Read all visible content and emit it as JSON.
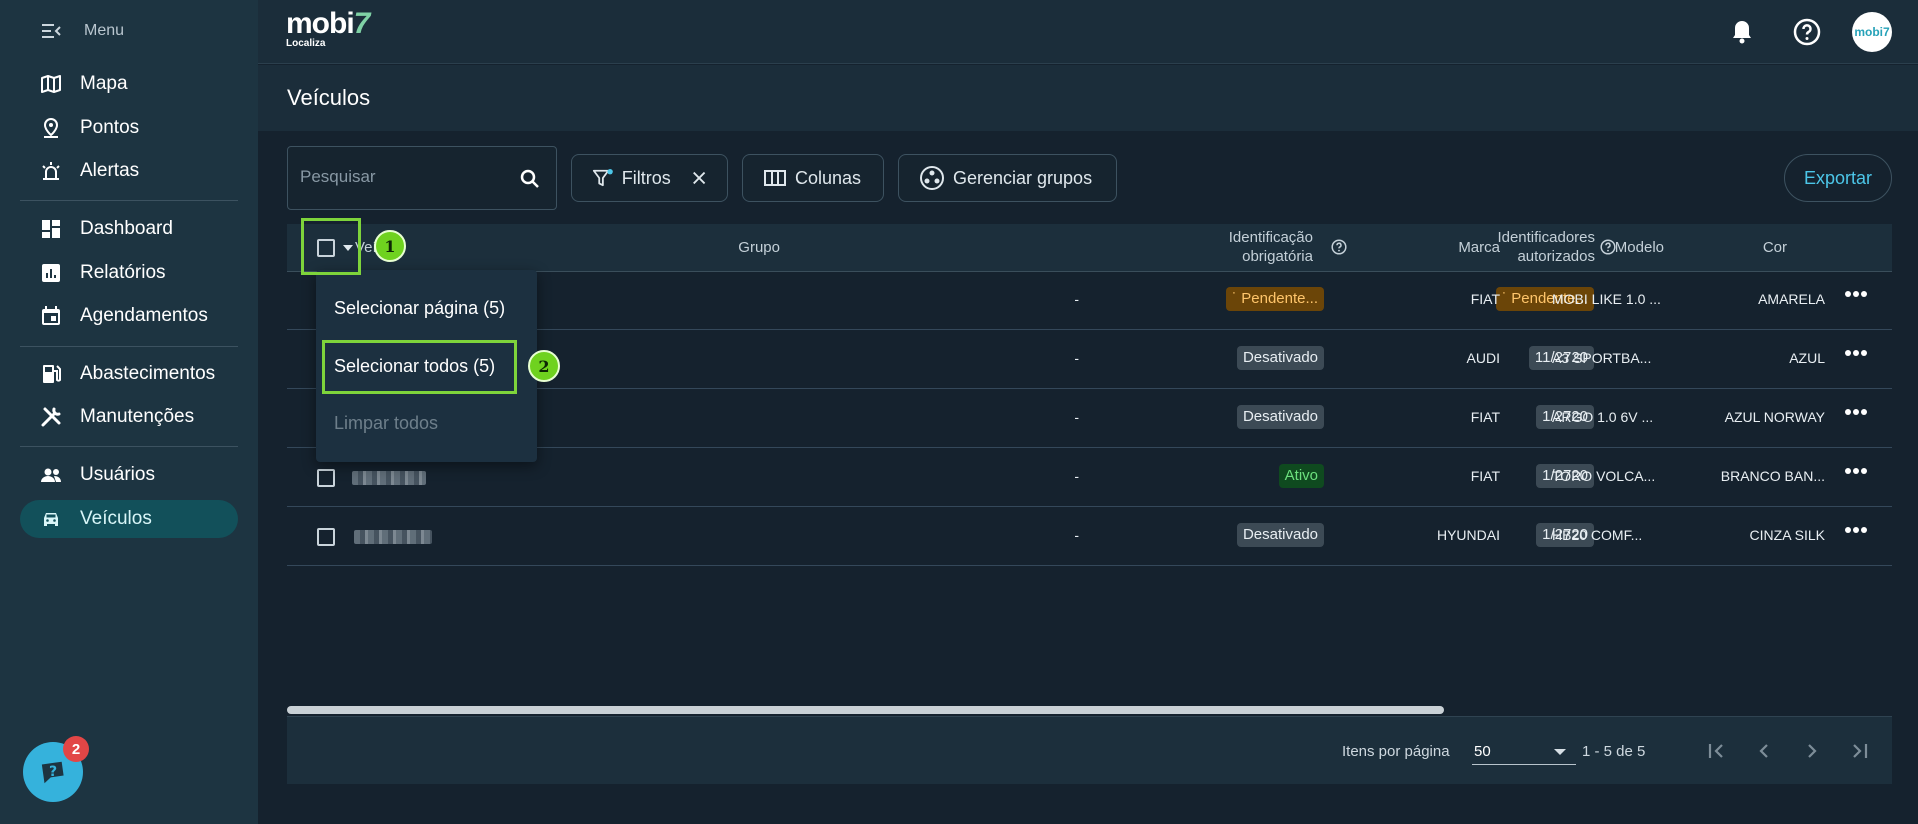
{
  "sidebar": {
    "menu_label": "Menu",
    "items": [
      {
        "label": "Mapa",
        "icon": "map-icon"
      },
      {
        "label": "Pontos",
        "icon": "location-pin-icon"
      },
      {
        "label": "Alertas",
        "icon": "siren-icon"
      },
      {
        "label": "Dashboard",
        "icon": "dashboard-icon"
      },
      {
        "label": "Relatórios",
        "icon": "report-icon"
      },
      {
        "label": "Agendamentos",
        "icon": "calendar-icon"
      },
      {
        "label": "Abastecimentos",
        "icon": "fuel-icon"
      },
      {
        "label": "Manutenções",
        "icon": "tools-icon"
      },
      {
        "label": "Usuários",
        "icon": "users-icon"
      },
      {
        "label": "Veículos",
        "icon": "car-icon",
        "active": true
      }
    ],
    "help_badge": "2"
  },
  "topbar": {
    "logo_main": "mobi",
    "logo_seven": "7",
    "logo_sub": "Localiza",
    "avatar_text": "mobi7"
  },
  "page": {
    "title": "Veículos"
  },
  "toolbar": {
    "search_placeholder": "Pesquisar",
    "filters_label": "Filtros",
    "columns_label": "Colunas",
    "groups_label": "Gerenciar grupos",
    "export_label": "Exportar"
  },
  "table": {
    "headers": {
      "vehicle": "Veículo",
      "group": "Grupo",
      "required_id_1": "Identificação",
      "required_id_2": "obrigatória",
      "authorized_1": "Identificadores",
      "authorized_2": "autorizados",
      "brand": "Marca",
      "model": "Modelo",
      "color": "Cor"
    },
    "rows": [
      {
        "group": "-",
        "required_id": "Pendente...",
        "required_status": "pending",
        "authorized": "Pendente...",
        "authorized_status": "pending",
        "brand": "FIAT",
        "model": "MOBI LIKE 1.0 ...",
        "color": "AMARELA"
      },
      {
        "group": "-",
        "required_id": "Desativado",
        "required_status": "off",
        "authorized": "11/2720",
        "authorized_status": "count",
        "brand": "AUDI",
        "model": "A3 SPORTBA...",
        "color": "AZUL"
      },
      {
        "group": "-",
        "required_id": "Desativado",
        "required_status": "off",
        "authorized": "1/2720",
        "authorized_status": "count",
        "brand": "FIAT",
        "model": "ARGO 1.0 6V ...",
        "color": "AZUL NORWAY"
      },
      {
        "group": "-",
        "required_id": "Ativo",
        "required_status": "on",
        "authorized": "1/2720",
        "authorized_status": "count",
        "brand": "FIAT",
        "model": "TORO VOLCA...",
        "color": "BRANCO BAN..."
      },
      {
        "group": "-",
        "required_id": "Desativado",
        "required_status": "off",
        "authorized": "1/2720",
        "authorized_status": "count",
        "brand": "HYUNDAI",
        "model": "HB20 COMF...",
        "color": "CINZA SILK"
      }
    ]
  },
  "select_menu": {
    "select_page": "Selecionar página (5)",
    "select_all": "Selecionar todos (5)",
    "clear_all": "Limpar todos"
  },
  "annotations": {
    "step1": "1",
    "step2": "2"
  },
  "pagination": {
    "items_per_page_label": "Itens por página",
    "items_per_page": "50",
    "range": "1 - 5 de 5"
  },
  "colors": {
    "sidebar_bg": "#1d3441",
    "active_nav": "#12505a",
    "accent": "#4cc6e8",
    "highlight": "#7ed43b",
    "pending": "#ffc56b",
    "active_status": "#6ce07e"
  }
}
